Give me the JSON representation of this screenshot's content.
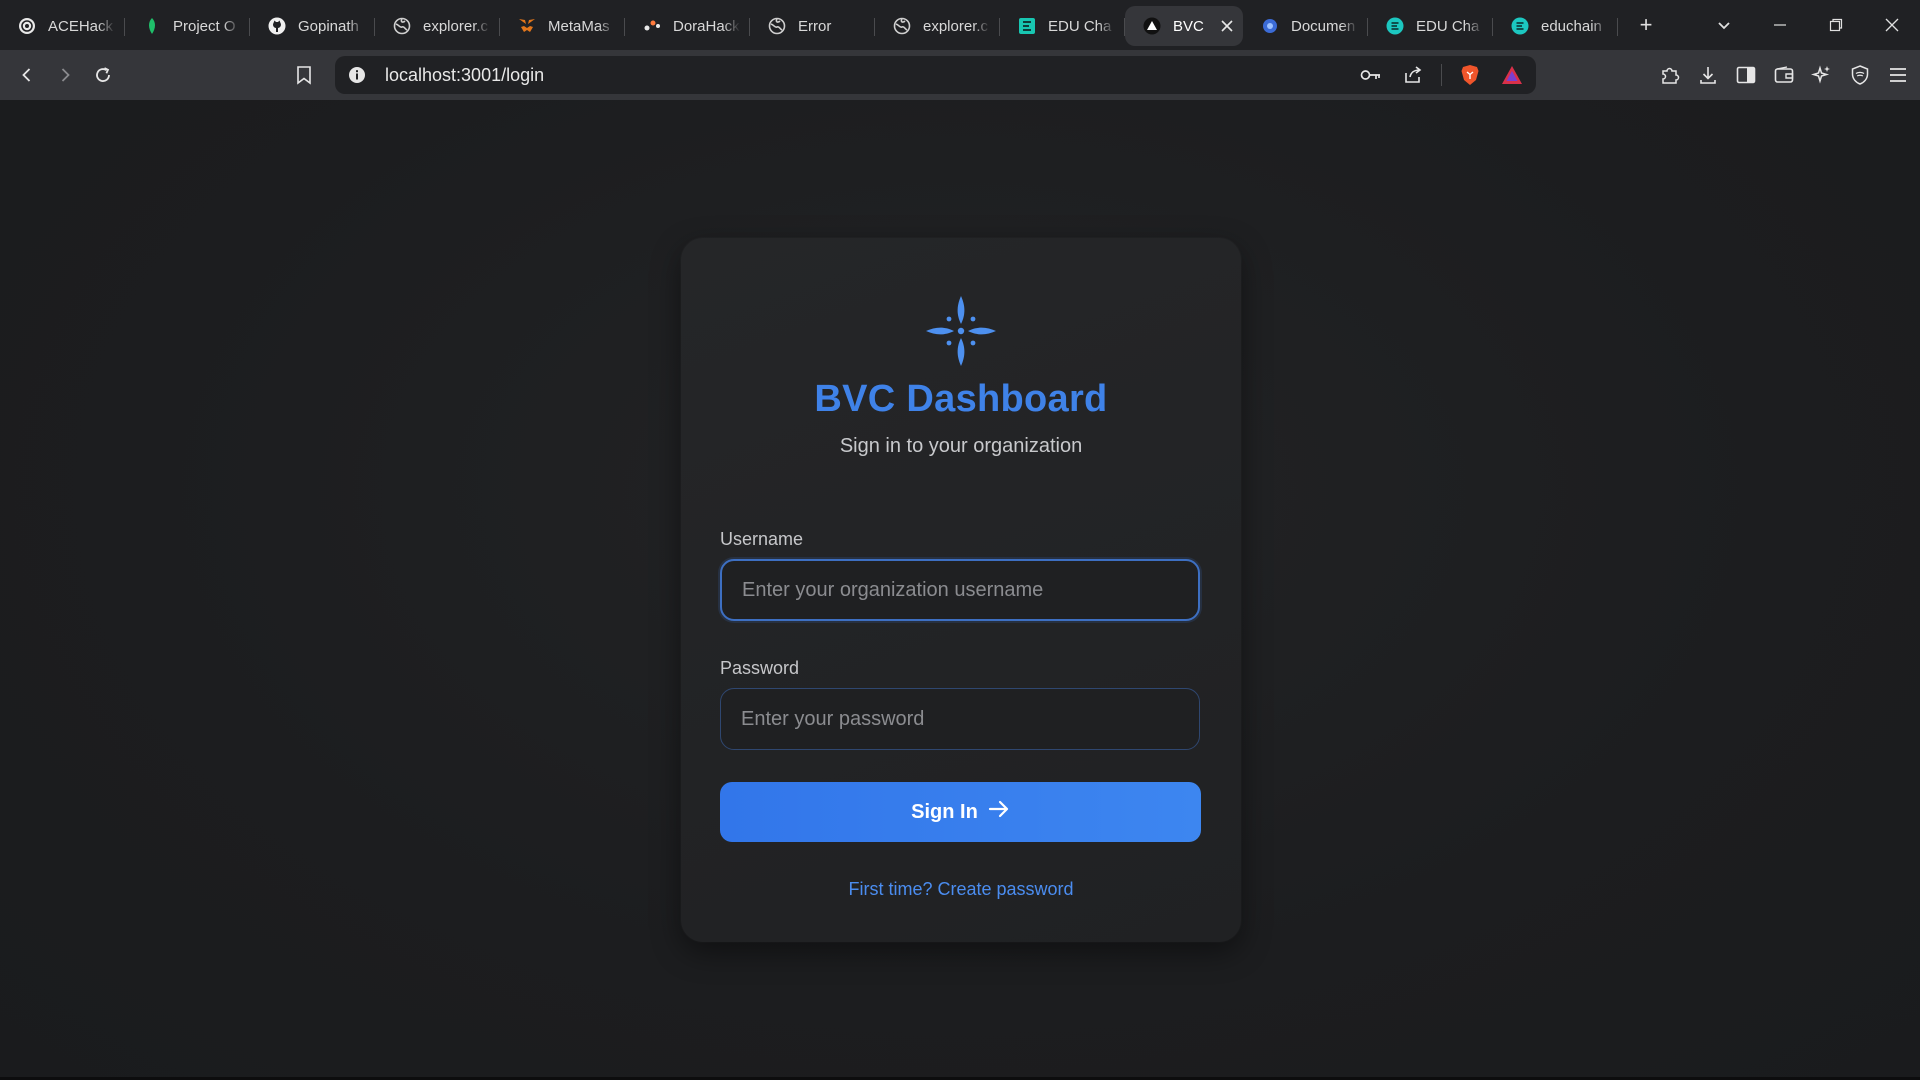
{
  "browser": {
    "tabs": [
      {
        "title": "ACEHack",
        "icon": "globe-dark-icon",
        "active": false
      },
      {
        "title": "Project O",
        "icon": "leaf-icon",
        "active": false
      },
      {
        "title": "Gopinath",
        "icon": "github-icon",
        "active": false
      },
      {
        "title": "explorer.c",
        "icon": "globe-icon",
        "active": false
      },
      {
        "title": "MetaMas",
        "icon": "metamask-icon",
        "active": false
      },
      {
        "title": "DoraHack",
        "icon": "dorahacks-icon",
        "active": false
      },
      {
        "title": "Error",
        "icon": "globe-icon",
        "active": false
      },
      {
        "title": "explorer.c",
        "icon": "globe-icon",
        "active": false
      },
      {
        "title": "EDU Cha",
        "icon": "edu-chain-icon",
        "active": false
      },
      {
        "title": "BVC",
        "icon": "triangle-icon",
        "active": true
      },
      {
        "title": "Documen",
        "icon": "docs-icon",
        "active": false
      },
      {
        "title": "EDU Cha",
        "icon": "edu-round-icon",
        "active": false
      },
      {
        "title": "educhain",
        "icon": "edu-round-icon",
        "active": false
      }
    ],
    "address": "localhost:3001/login",
    "colors": {
      "tabbar": "#202124",
      "toolbar": "#35363a",
      "omnibox": "#202124"
    }
  },
  "login": {
    "logo_icon": "four-petal-star-icon",
    "title": "BVC Dashboard",
    "subtitle": "Sign in to your organization",
    "username_label": "Username",
    "username_placeholder": "Enter your organization username",
    "username_value": "",
    "password_label": "Password",
    "password_placeholder": "Enter your password",
    "password_value": "",
    "signin_label": "Sign In",
    "create_password_link": "First time? Create password",
    "colors": {
      "accent": "#3f82e8",
      "button": "#3479ec",
      "link": "#4b8df0",
      "card": "#242527",
      "page": "#1c1d1f"
    }
  }
}
